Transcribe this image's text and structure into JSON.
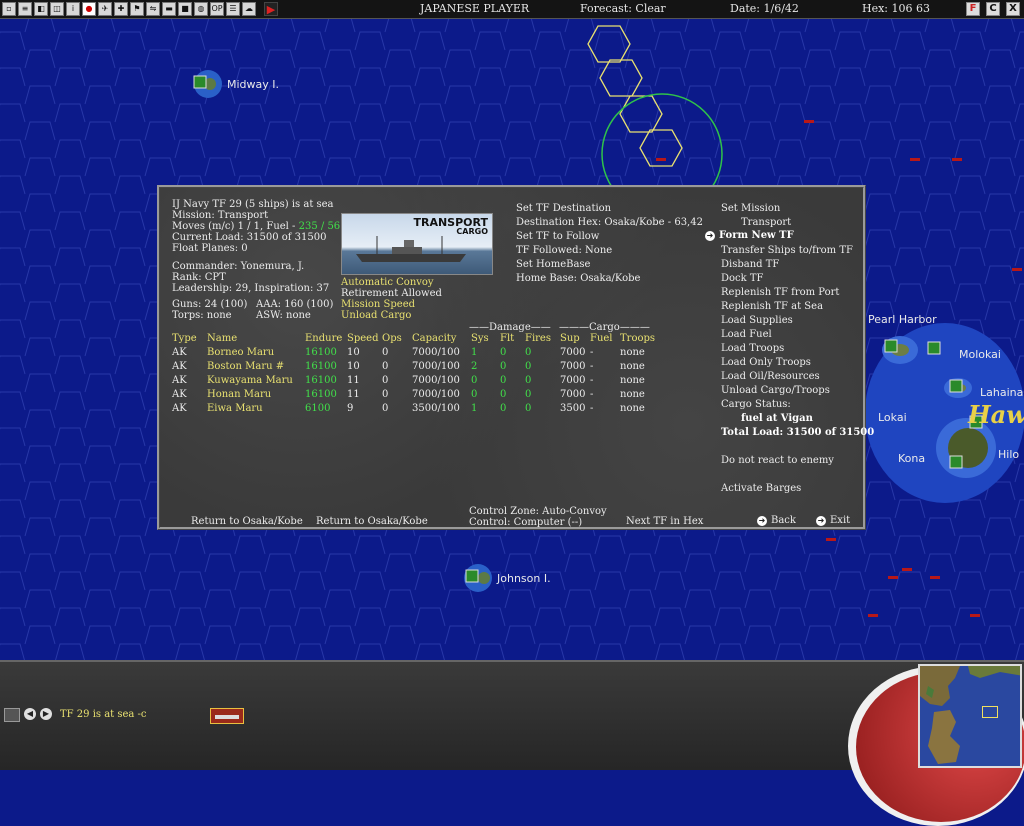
{
  "topbar": {
    "side": "JAPANESE PLAYER",
    "forecast": "Forecast: Clear",
    "date": "Date: 1/6/42",
    "hex": "Hex: 106 63",
    "icons": [
      "save-icon",
      "report-icon",
      "intel-icon",
      "group-icon",
      "info-icon",
      "japan-flag-icon",
      "plane-icon",
      "air-icon",
      "flag-icon",
      "sub-icon",
      "ship-icon",
      "pin-icon",
      "globe-icon",
      "op-icon",
      "list-icon",
      "cloud-icon"
    ],
    "op_label": "OP",
    "right_buttons": [
      "F",
      "C",
      "X"
    ]
  },
  "map": {
    "labels": {
      "midway": "Midway I.",
      "pearl": "Pearl Harbor",
      "molokai": "Molokai",
      "lahaina": "Lahaina",
      "lokai": "Lokai",
      "kona": "Kona",
      "hilo": "Hilo",
      "hawaii": "Haw",
      "johnston": "Johnson I."
    }
  },
  "panel": {
    "header": {
      "line1": "IJ Navy TF 29 (5 ships) is at sea",
      "line2": "Mission: Transport",
      "moves_prefix": "Moves (m/c) 1 / 1, Fuel - ",
      "fuel": "235 / 56",
      "line4": "Current Load: 31500 of 31500",
      "line5": "Float Planes: 0",
      "commander": "Commander: Yonemura, J.",
      "rank": "Rank: CPT",
      "leadership": "Leadership: 29, Inspiration: 37",
      "guns": "Guns: 24 (100)",
      "aaa": "AAA: 160 (100)",
      "torps": "Torps: none",
      "asw": "ASW: none"
    },
    "banner": {
      "title": "TRANSPORT",
      "subtitle": "CARGO"
    },
    "options": {
      "convoy": "Automatic Convoy",
      "retire": "Retirement Allowed",
      "speed": "Mission Speed",
      "unload": "Unload Cargo"
    },
    "mid_links": {
      "set_dest": "Set TF Destination",
      "dest_hex": "Destination Hex: Osaka/Kobe - 63,42",
      "set_follow": "Set TF to Follow",
      "followed": "TF Followed: None",
      "set_home": "Set HomeBase",
      "home_base": "Home Base: Osaka/Kobe"
    },
    "right_menu": {
      "set_mission": "Set Mission",
      "mission_value": "Transport",
      "form_new": "Form New TF",
      "transfer": "Transfer Ships to/from TF",
      "disband": "Disband TF",
      "dock": "Dock TF",
      "replenish_port": "Replenish TF from Port",
      "replenish_sea": "Replenish TF at Sea",
      "load_supplies": "Load Supplies",
      "load_fuel": "Load Fuel",
      "load_troops": "Load Troops",
      "load_only_troops": "Load Only Troops",
      "load_oil": "Load Oil/Resources",
      "unload": "Unload Cargo/Troops",
      "cargo_status": "Cargo Status:",
      "cargo_value": "fuel at Vigan",
      "total_load": "Total Load: 31500 of 31500",
      "no_react": "Do not react to enemy",
      "barges": "Activate Barges"
    },
    "table": {
      "group_damage": "Damage",
      "group_cargo": "Cargo",
      "headers": [
        "Type",
        "Name",
        "Endure",
        "Speed",
        "Ops",
        "Capacity",
        "Sys",
        "Flt",
        "Fires",
        "Sup",
        "Fuel",
        "Troops"
      ],
      "rows": [
        [
          "AK",
          "Borneo Maru",
          "16100",
          "10",
          "0",
          "7000/100",
          "1",
          "0",
          "0",
          "7000",
          "-",
          "none"
        ],
        [
          "AK",
          "Boston Maru #",
          "16100",
          "10",
          "0",
          "7000/100",
          "2",
          "0",
          "0",
          "7000",
          "-",
          "none"
        ],
        [
          "AK",
          "Kuwayama Maru",
          "16100",
          "11",
          "0",
          "7000/100",
          "0",
          "0",
          "0",
          "7000",
          "-",
          "none"
        ],
        [
          "AK",
          "Honan Maru",
          "16100",
          "11",
          "0",
          "7000/100",
          "0",
          "0",
          "0",
          "7000",
          "-",
          "none"
        ],
        [
          "AK",
          "Eiwa Maru",
          "6100",
          "9",
          "0",
          "3500/100",
          "1",
          "0",
          "0",
          "3500",
          "-",
          "none"
        ]
      ]
    },
    "footer": {
      "return1": "Return to Osaka/Kobe",
      "return2": "Return to Osaka/Kobe",
      "control_zone": "Control Zone: Auto-Convoy",
      "control": "Control:    Computer (--)",
      "next_tf": "Next TF in Hex",
      "back": "Back",
      "exit": "Exit"
    }
  },
  "bottombar": {
    "status": "TF 29 is at sea -c"
  },
  "colors": {
    "ocean": "#0c1a8a",
    "hex_line": "#2838a8",
    "highlight": "#e8e070",
    "green": "#41e04a"
  }
}
